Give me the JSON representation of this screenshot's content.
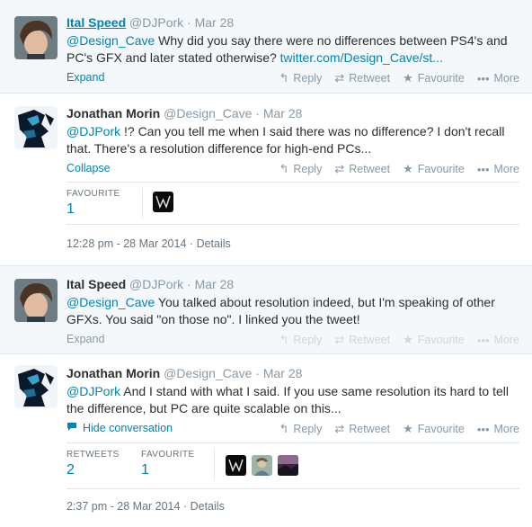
{
  "actions": {
    "reply": "Reply",
    "retweet": "Retweet",
    "favourite": "Favourite",
    "more": "More"
  },
  "tweets": [
    {
      "name": "Ital Speed",
      "handle": "@DJPork",
      "sep": "·",
      "date": "Mar 28",
      "mention": "@Design_Cave",
      "text": " Why did you say there were no differences between PS4's and PC's GFX and later stated otherwise? ",
      "link": "twitter.com/Design_Cave/st...",
      "toggle": "Expand"
    },
    {
      "name": "Jonathan Morin",
      "handle": "@Design_Cave",
      "sep": "·",
      "date": "Mar 28",
      "mention": "@DJPork",
      "text": " !? Can you tell me when I said there was no difference? I don't recall that. There's a resolution difference for high-end PCs...",
      "toggle": "Collapse",
      "stats": {
        "favourite_label": "FAVOURITE",
        "favourite_count": "1"
      },
      "timestamp": "12:28 pm - 28 Mar 2014",
      "details": "Details"
    },
    {
      "name": "Ital Speed",
      "handle": "@DJPork",
      "sep": "·",
      "date": "Mar 28",
      "mention": "@Design_Cave",
      "text": " You talked about resolution indeed, but I'm speaking of other GFXs. You said \"on those no\". I linked you the tweet!",
      "toggle": "Expand"
    },
    {
      "name": "Jonathan Morin",
      "handle": "@Design_Cave",
      "sep": "·",
      "date": "Mar 28",
      "mention": "@DJPork",
      "text": " And I stand with what I said. If you use same resolution its hard to tell the difference, but PC are quite scalable on this...",
      "toggle": "Hide conversation",
      "stats": {
        "retweets_label": "RETWEETS",
        "retweets_count": "2",
        "favourite_label": "FAVOURITE",
        "favourite_count": "1"
      },
      "timestamp": "2:37 pm - 28 Mar 2014",
      "details": "Details"
    }
  ],
  "icons": {
    "reply": "reply-icon",
    "retweet": "retweet-icon",
    "favourite": "star-icon",
    "more": "ellipsis-icon",
    "hide": "speech-bubble-icon"
  },
  "colors": {
    "link": "#0084b4",
    "muted": "#8899a6",
    "highlight_bg": "#f5f8fa"
  }
}
